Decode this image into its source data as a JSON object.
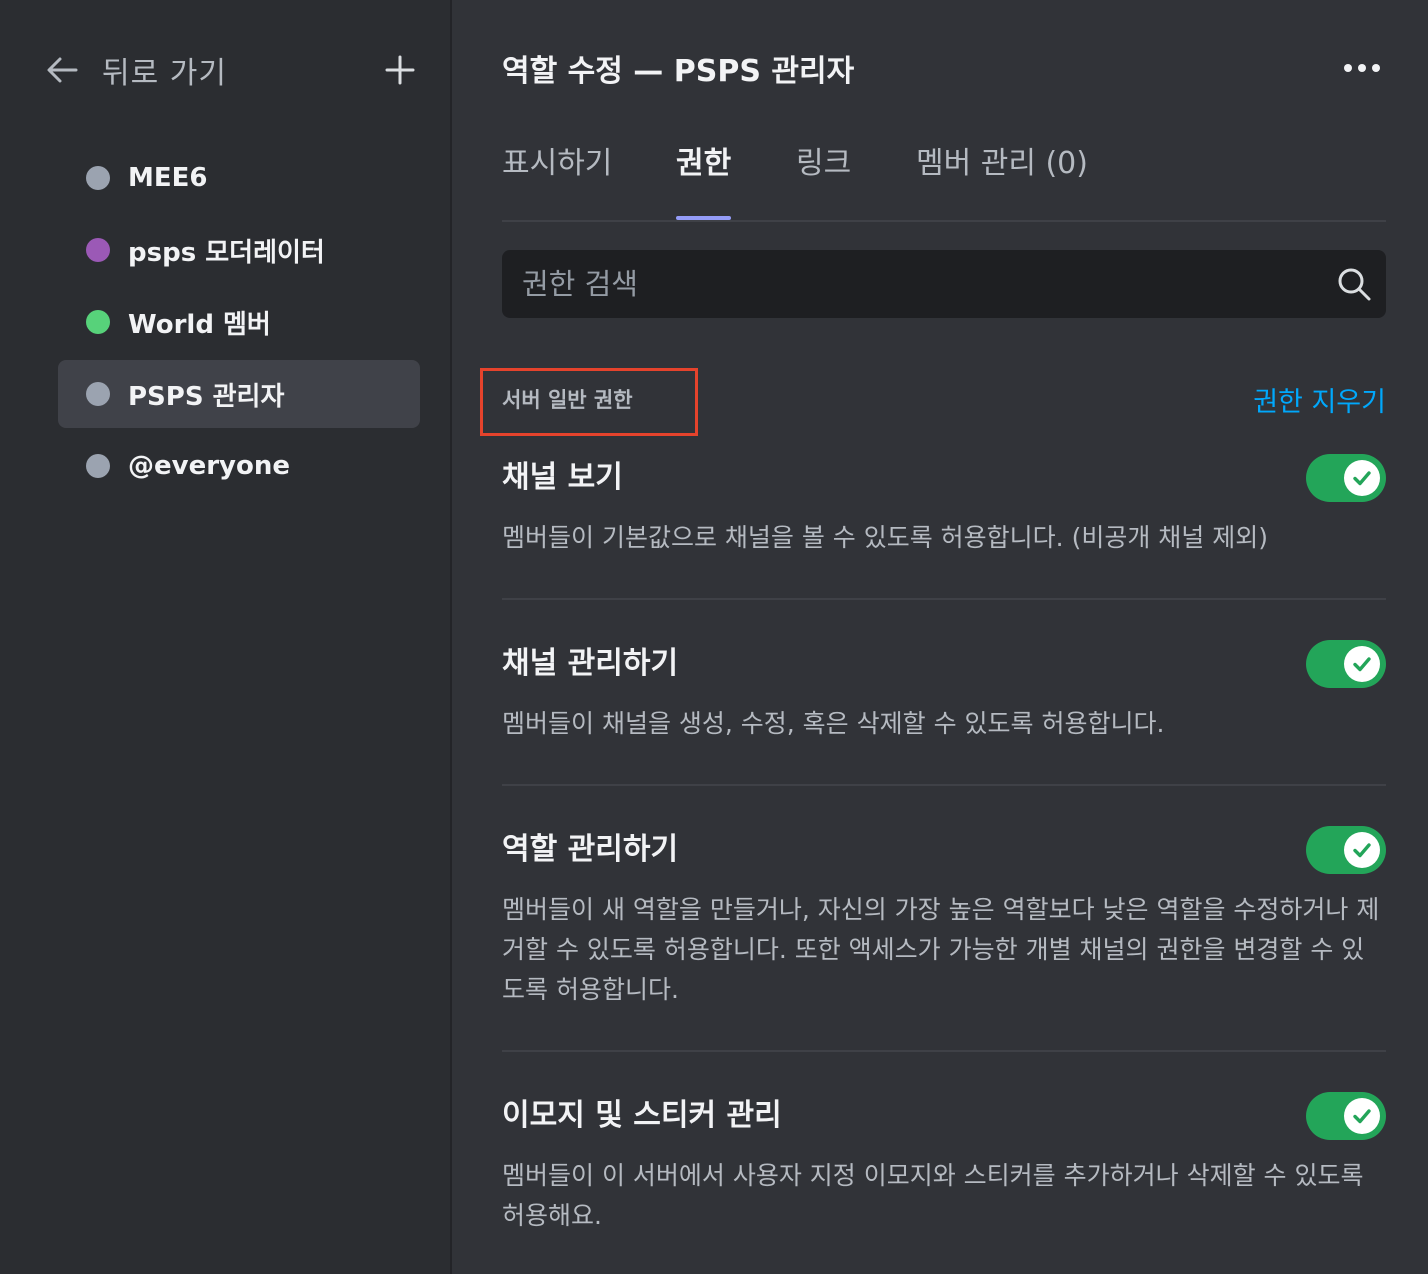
{
  "sidebar": {
    "back_label": "뒤로 가기",
    "back_icon": "arrow-left-icon",
    "add_icon": "plus-icon",
    "roles": [
      {
        "name": "MEE6",
        "color": "#9ba3b0"
      },
      {
        "name": "psps 모더레이터",
        "color": "#9b59b6"
      },
      {
        "name": "World 멤버",
        "color": "#57d27a"
      },
      {
        "name": "PSPS 관리자",
        "color": "#9ba3b0",
        "selected": true
      },
      {
        "name": "@everyone",
        "color": "#9ba3b0"
      }
    ]
  },
  "header": {
    "title": "역할 수정 — PSPS 관리자",
    "more_icon": "more-horizontal-icon"
  },
  "tabs": [
    {
      "label": "표시하기"
    },
    {
      "label": "권한",
      "active": true
    },
    {
      "label": "링크"
    },
    {
      "label": "멤버 관리 (0)"
    }
  ],
  "search": {
    "placeholder": "권한 검색",
    "value": "",
    "icon": "search-icon"
  },
  "section": {
    "title": "서버 일반 권한",
    "clear_label": "권한 지우기"
  },
  "permissions": [
    {
      "title": "채널 보기",
      "description": "멤버들이 기본값으로 채널을 볼 수 있도록 허용합니다. (비공개 채널 제외)",
      "enabled": true
    },
    {
      "title": "채널 관리하기",
      "description": "멤버들이 채널을 생성, 수정, 혹은 삭제할 수 있도록 허용합니다.",
      "enabled": true
    },
    {
      "title": "역할 관리하기",
      "description": "멤버들이 새 역할을 만들거나, 자신의 가장 높은 역할보다 낮은 역할을 수정하거나 제거할 수 있도록 허용합니다. 또한 액세스가 가능한 개별 채널의 권한을 변경할 수 있도록 허용합니다.",
      "enabled": true
    },
    {
      "title": "이모지 및 스티커 관리",
      "description": "멤버들이 이 서버에서 사용자 지정 이모지와 스티커를 추가하거나 삭제할 수 있도록 허용해요.",
      "enabled": true
    }
  ],
  "colors": {
    "toggle_on": "#23a559",
    "link": "#00a8fc",
    "tab_indicator": "#949cf7",
    "highlight": "#e5432c"
  }
}
